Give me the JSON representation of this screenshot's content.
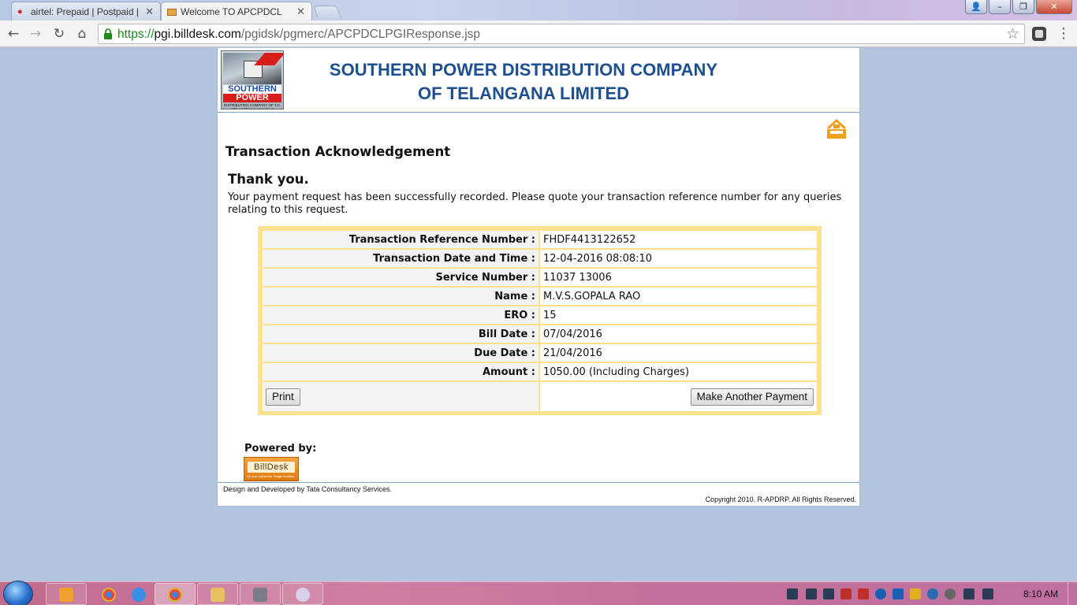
{
  "browser": {
    "tabs": [
      {
        "label": "airtel: Prepaid | Postpaid | ",
        "active": false
      },
      {
        "label": "Welcome TO APCPDCL",
        "active": true
      }
    ],
    "url_scheme": "https://",
    "url_host": "pgi.billdesk.com",
    "url_path": "/pgidsk/pgmerc/APCPDCLPGIResponse.jsp"
  },
  "header": {
    "logo_top": "SOUTHERN",
    "logo_bottom": "POWER",
    "logo_sub": "DISTRIBUTION COMPANY OF T.G. LTD. Lighting up your lives!",
    "company_line1": "SOUTHERN POWER DISTRIBUTION COMPANY",
    "company_line2": "OF TELANGANA LIMITED"
  },
  "page": {
    "title": "Transaction Acknowledgement",
    "thanks": "Thank you.",
    "message": "Your payment request has been successfully recorded. Please quote your transaction reference number for any queries relating to this request."
  },
  "transaction": {
    "rows": [
      {
        "label": "Transaction Reference Number :",
        "value": "FHDF4413122652"
      },
      {
        "label": "Transaction Date and Time :",
        "value": "12-04-2016 08:08:10"
      },
      {
        "label": "Service Number :",
        "value": "11037 13006"
      },
      {
        "label": "Name :",
        "value": "M.V.S.GOPALA RAO"
      },
      {
        "label": "ERO :",
        "value": "15"
      },
      {
        "label": "Bill Date :",
        "value": "07/04/2016"
      },
      {
        "label": "Due Date :",
        "value": "21/04/2016"
      },
      {
        "label": "Amount :",
        "value": "1050.00 (Including Charges)"
      }
    ],
    "print_label": "Print",
    "another_label": "Make Another Payment"
  },
  "footer": {
    "powered_by": "Powered by:",
    "billdesk_name": "BillDesk",
    "billdesk_tag": "All your payments. Single location.",
    "designed": "Design and Developed by Tata Consultancy Services.",
    "copyright": "Copyright 2010. R-APDRP. All Rights Reserved."
  },
  "taskbar": {
    "clock": "8:10 AM"
  },
  "colors": {
    "company_blue": "#1d4f91",
    "table_border": "#fae28f",
    "secure_green": "#1b8a1b"
  }
}
